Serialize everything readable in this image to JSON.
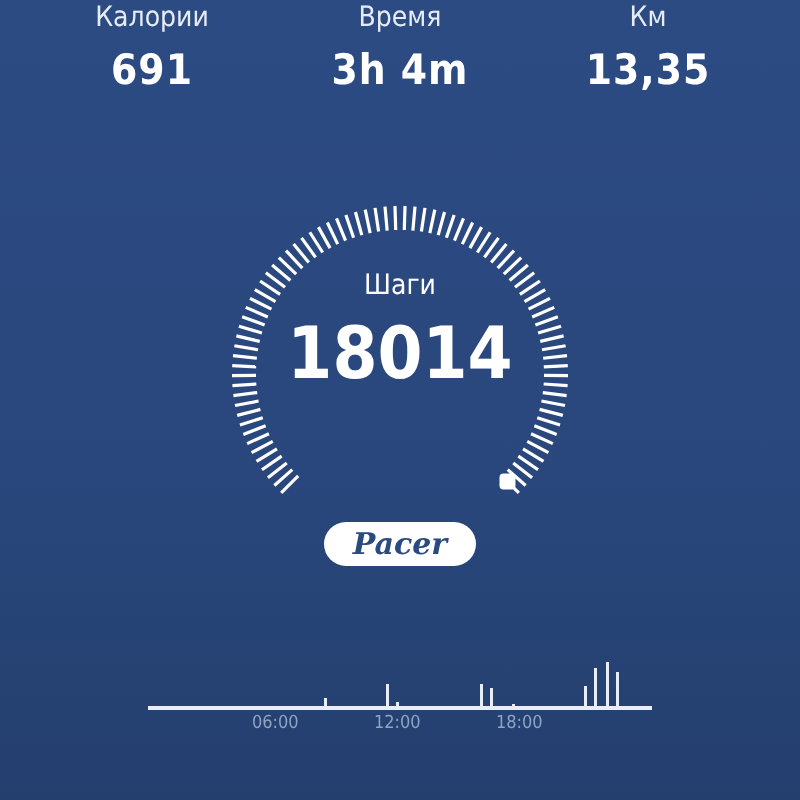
{
  "stats": [
    {
      "label": "Калории",
      "value": "691"
    },
    {
      "label": "Время",
      "value": "3h 4m"
    },
    {
      "label": "Км",
      "value": "13,35"
    }
  ],
  "gauge": {
    "label": "Шаги",
    "value": "18014"
  },
  "badge": "Pacer",
  "timeline": {
    "labels": [
      "06:00",
      "12:00",
      "18:00"
    ]
  }
}
